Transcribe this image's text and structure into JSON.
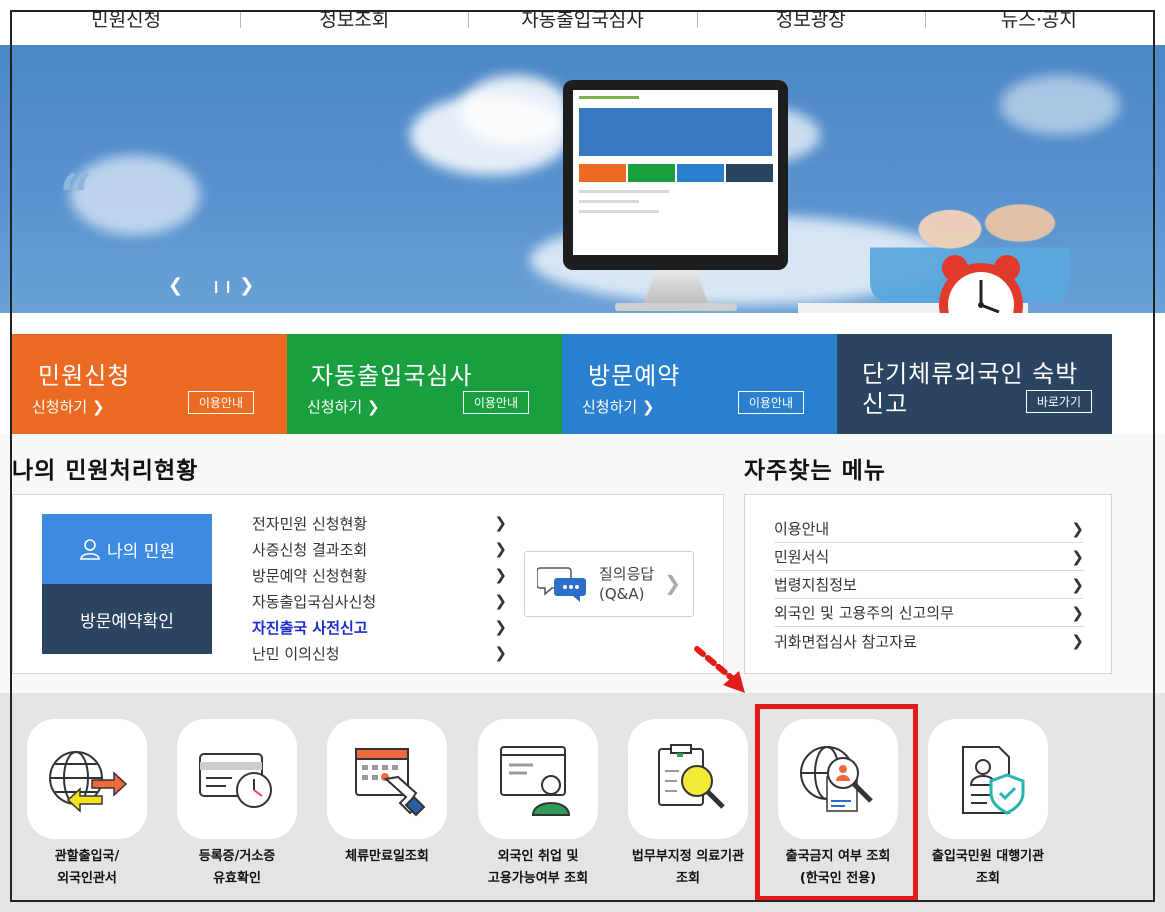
{
  "nav": [
    "민원신청",
    "정보조회",
    "자동출입국심사",
    "정보광장",
    "뉴스·공지"
  ],
  "tiles": [
    {
      "title": "민원신청",
      "sub": "신청하기",
      "btn": "이용안내",
      "color": "#eb6b22"
    },
    {
      "title": "자동출입국심사",
      "sub": "신청하기",
      "btn": "이용안내",
      "color": "#1a9f40"
    },
    {
      "title": "방문예약",
      "sub": "신청하기",
      "btn": "이용안내",
      "color": "#2b7fcf"
    },
    {
      "title": "단기체류외국인 숙박 신고",
      "btn": "바로가기",
      "color": "#2b4461"
    }
  ],
  "status": {
    "title": "나의 민원처리현황",
    "my_button": "나의 민원",
    "visit_button": "방문예약확인",
    "items": [
      "전자민원 신청현황",
      "사증신청 결과조회",
      "방문예약 신청현황",
      "자동출입국심사신청",
      "자진출국 사전신고",
      "난민 이의신청"
    ],
    "qna": {
      "line1": "질의응답",
      "line2": "(Q&A)"
    }
  },
  "favorites": {
    "title": "자주찾는 메뉴",
    "items": [
      "이용안내",
      "민원서식",
      "법령지침정보",
      "외국인 및 고용주의 신고의무",
      "귀화면접심사 참고자료"
    ]
  },
  "quick_icons": [
    {
      "line1": "관할출입국/",
      "line2": "외국인관서",
      "icon": "globe-arrows-icon"
    },
    {
      "line1": "등록증/거소증",
      "line2": "유효확인",
      "icon": "card-clock-icon"
    },
    {
      "line1": "체류만료일조회",
      "line2": "",
      "icon": "calendar-hand-icon"
    },
    {
      "line1": "외국인 취업 및",
      "line2": "고용가능여부 조회",
      "icon": "monitor-person-icon"
    },
    {
      "line1": "법무부지정 의료기관",
      "line2": "조회",
      "icon": "clipboard-magnifier-icon"
    },
    {
      "line1": "출국금지 여부 조회",
      "line2": "(한국인 전용)",
      "icon": "globe-magnifier-icon"
    },
    {
      "line1": "출입국민원 대행기관",
      "line2": "조회",
      "icon": "document-shield-icon"
    }
  ],
  "colors": {
    "highlight_box": "#e21b1b",
    "link_highlight": "#1c2bd1",
    "banner_blue": "#4c87c6"
  }
}
